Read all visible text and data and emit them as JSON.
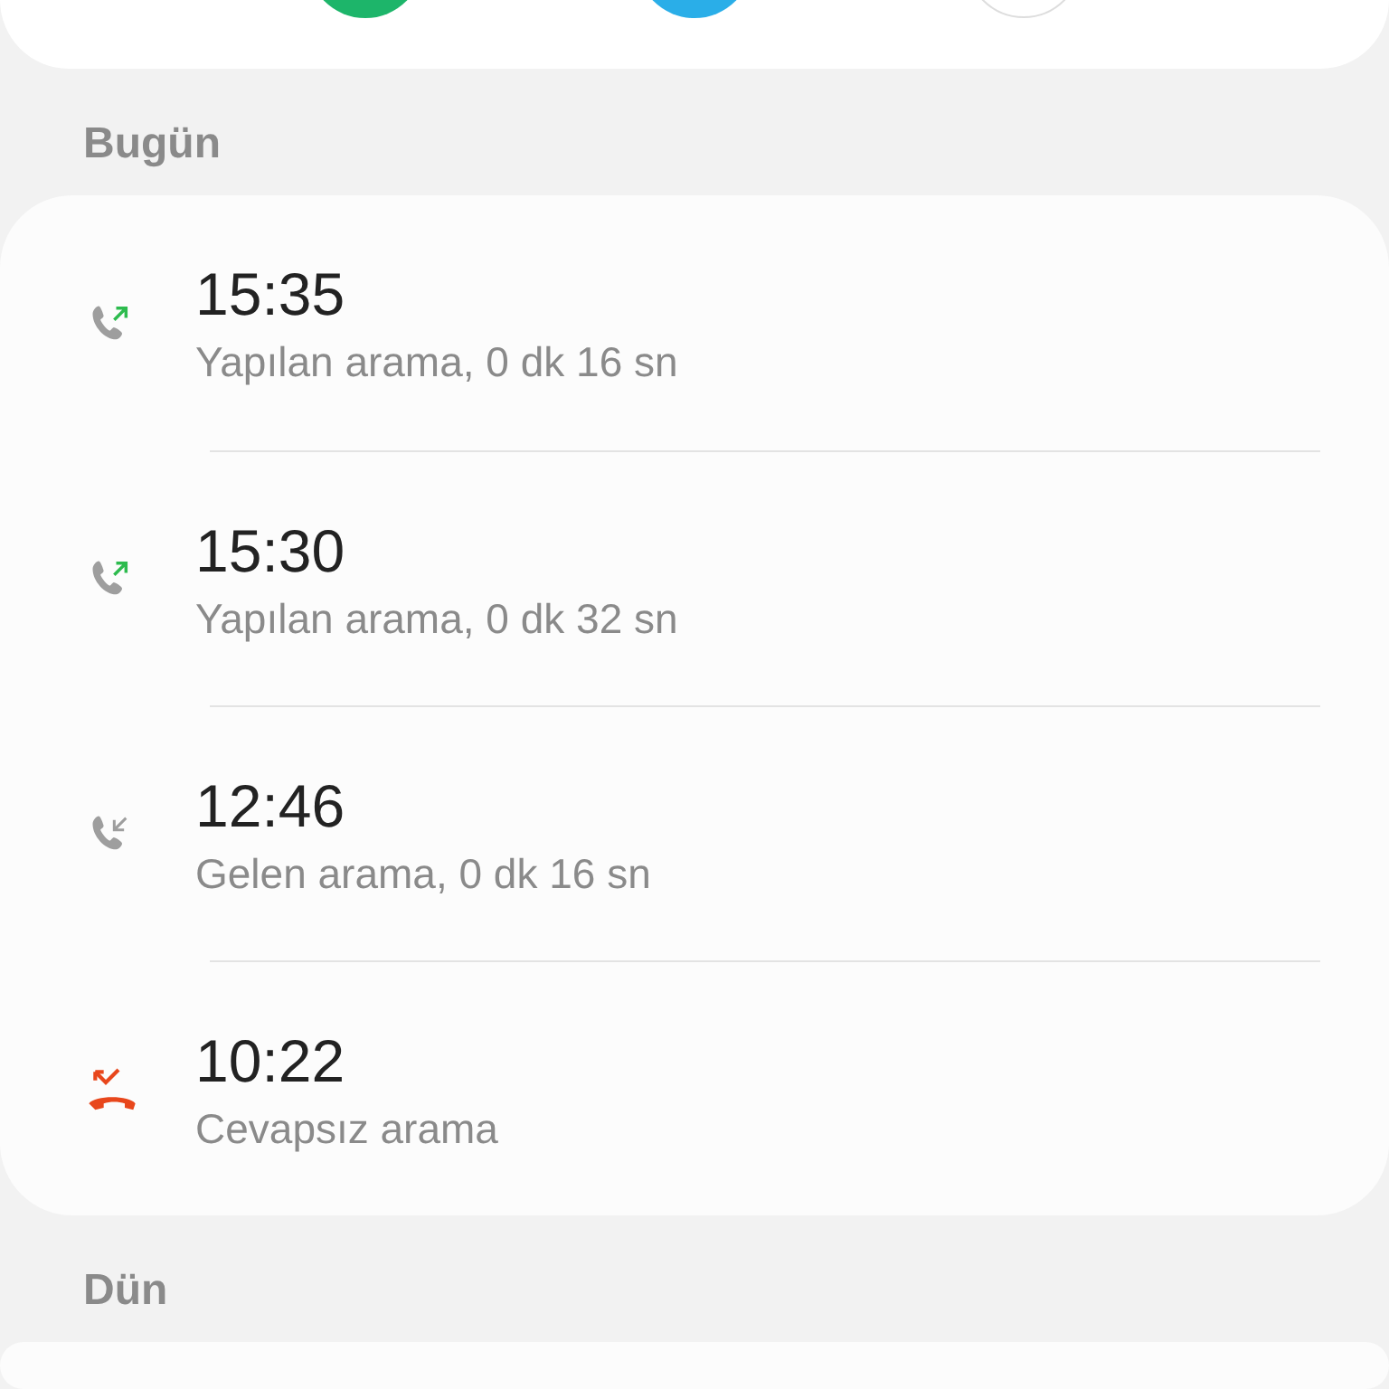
{
  "quick_actions": [
    {
      "color": "#1db56a"
    },
    {
      "color": "#2aaee8"
    },
    {
      "color": "#ffffff"
    }
  ],
  "sections": [
    {
      "title": "Bugün",
      "calls": [
        {
          "kind": "outgoing",
          "time": "15:35",
          "detail": "Yapılan arama, 0 dk 16 sn"
        },
        {
          "kind": "outgoing",
          "time": "15:30",
          "detail": "Yapılan arama, 0 dk 32 sn"
        },
        {
          "kind": "incoming",
          "time": "12:46",
          "detail": "Gelen arama, 0 dk 16 sn"
        },
        {
          "kind": "missed",
          "time": "10:22",
          "detail": "Cevapsız arama"
        }
      ]
    },
    {
      "title": "Dün"
    }
  ]
}
